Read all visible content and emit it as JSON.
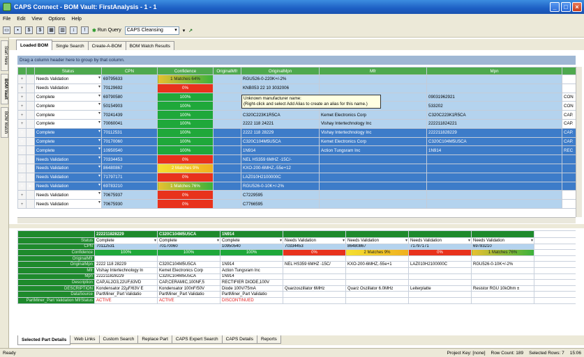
{
  "window": {
    "title": "CAPS Connect - BOM Vault: FirstAnalysis - 1 - 1"
  },
  "menu": [
    "File",
    "Edit",
    "View",
    "Options",
    "Help"
  ],
  "toolbar": {
    "run_query": "Run Query",
    "query_select": "CAPS Cleansing"
  },
  "side_tabs": [
    "Start Here",
    "BOM Vault",
    "BOM Watch"
  ],
  "top_tabs": [
    "Loaded BOM",
    "Single Search",
    "Create-A-BOM",
    "BOM Watch Results"
  ],
  "group_hint": "Drag a column header here to group by that column.",
  "grid": {
    "columns": [
      "Status",
      "CPN",
      "Confidence",
      "OriginalMfr",
      "OriginalMpn",
      "Mfr",
      "Mpn",
      ""
    ],
    "rows": [
      {
        "status": "Needs Validation",
        "cpn": "69795633",
        "conf": "1 Matches 64%",
        "ctype": "mixed",
        "omfr": "",
        "ompn": "RGU526-0-220K+/-2%",
        "mfr": "",
        "mpn": "",
        "extra": "",
        "sel": false
      },
      {
        "status": "Needs Validation",
        "cpn": "70129692",
        "conf": "0%",
        "ctype": "red",
        "omfr": "",
        "ompn": "KNB053 22 10 3032006",
        "mfr": "",
        "mpn": "",
        "extra": "",
        "sel": false
      },
      {
        "status": "Complete",
        "cpn": "69790580",
        "conf": "100%",
        "ctype": "green",
        "omfr": "",
        "ompn": "",
        "mfr": "",
        "mpn": "09031962921",
        "extra": "CON",
        "sel": false
      },
      {
        "status": "Complete",
        "cpn": "50154903",
        "conf": "100%",
        "ctype": "green",
        "omfr": "",
        "ompn": "533202",
        "mfr": "Emi Electronics Inc",
        "mpn": "533202",
        "extra": "CON",
        "sel": false
      },
      {
        "status": "Complete",
        "cpn": "70241439",
        "conf": "100%",
        "ctype": "green",
        "omfr": "",
        "ompn": "C320C223K1R5CA",
        "mfr": "Kemet Electronics Corp",
        "mpn": "C320C223K1R5CA",
        "extra": "CAP.",
        "sel": false
      },
      {
        "status": "Complete",
        "cpn": "70060041",
        "conf": "100%",
        "ctype": "green",
        "omfr": "",
        "ompn": "2222 118 24221",
        "mfr": "Vishay Intertechnology Inc",
        "mpn": "222211824221",
        "extra": "CAP.",
        "sel": false
      },
      {
        "status": "Complete",
        "cpn": "70112531",
        "conf": "100%",
        "ctype": "green",
        "omfr": "",
        "ompn": "2222 118 28229",
        "mfr": "Vishay Intertechnology Inc",
        "mpn": "222211828229",
        "extra": "CAP.",
        "sel": true
      },
      {
        "status": "Complete",
        "cpn": "70170060",
        "conf": "100%",
        "ctype": "green",
        "omfr": "",
        "ompn": "C320C104M5U5CA",
        "mfr": "Kemet Electronics Corp",
        "mpn": "C320C104M5U5CA",
        "extra": "CAP.",
        "sel": true
      },
      {
        "status": "Complete",
        "cpn": "10950540",
        "conf": "100%",
        "ctype": "green",
        "omfr": "",
        "ompn": "1N914",
        "mfr": "Action Tungsram Inc",
        "mpn": "1N914",
        "extra": "REC",
        "sel": true
      },
      {
        "status": "Needs Validation",
        "cpn": "70334453",
        "conf": "0%",
        "ctype": "red",
        "omfr": "",
        "ompn": "NEL HS359 6MHZ -15C/-",
        "mfr": "",
        "mpn": "",
        "extra": "",
        "sel": true
      },
      {
        "status": "Needs Validation",
        "cpn": "86480867",
        "conf": "2 Matches 9%",
        "ctype": "yellow",
        "omfr": "",
        "ompn": "KXO-200-6MHZ,-55e+12",
        "mfr": "",
        "mpn": "",
        "extra": "",
        "sel": true
      },
      {
        "status": "Needs Validation",
        "cpn": "71797171",
        "conf": "0%",
        "ctype": "red",
        "omfr": "",
        "ompn": "LAZ010H2100000C",
        "mfr": "",
        "mpn": "",
        "extra": "",
        "sel": true
      },
      {
        "status": "Needs Validation",
        "cpn": "69783210",
        "conf": "1 Matches 76%",
        "ctype": "mixed",
        "omfr": "",
        "ompn": "RGU526-0-10K+/-2%",
        "mfr": "",
        "mpn": "",
        "extra": "",
        "sel": true
      },
      {
        "status": "Needs Validation",
        "cpn": "70675937",
        "conf": "0%",
        "ctype": "red",
        "omfr": "",
        "ompn": "C7229595",
        "mfr": "",
        "mpn": "",
        "extra": "",
        "sel": false
      },
      {
        "status": "Needs Validation",
        "cpn": "70675930",
        "conf": "0%",
        "ctype": "red",
        "omfr": "",
        "ompn": "C7766595",
        "mfr": "",
        "mpn": "",
        "extra": "",
        "sel": false
      }
    ]
  },
  "tooltip": {
    "line1": "Unknown manufacturer name:",
    "line2": "(Right-click and select Add Alias to create an alias for this name.)"
  },
  "details": {
    "labels": [
      "Status",
      "CPN",
      "Confidence",
      "OriginalMfr",
      "OriginalMpn",
      "Mfr",
      "Mpn",
      "Description",
      "DESCRIPTION",
      "DataSource",
      "PartMiner_Part Validation MfrStatus"
    ],
    "headers": [
      "222211828229",
      "C320C104M5U5CA",
      "1N914",
      "",
      "",
      "",
      ""
    ],
    "cols": [
      {
        "status": "Complete",
        "cpn": "70112531",
        "conf": "100%",
        "ctype": "green",
        "omfr": "",
        "ompn": "2222 118 28229",
        "mfr": "Vishay Intertechnology In",
        "mpn": "222211828229",
        "desc": "CAP,AL2O3,22UF,63VD",
        "desc2": "Kondensator 22µF/63V E",
        "ds": "PartMiner_Part Validatio",
        "ms": "ACTIVE"
      },
      {
        "status": "Complete",
        "cpn": "70170060",
        "conf": "100%",
        "ctype": "green",
        "omfr": "",
        "ompn": "C320C104M5U5CA",
        "mfr": "Kemet Electronics Corp",
        "mpn": "C320C104M5U5CA",
        "desc": "CAP,CERAMIC,100NF,5",
        "desc2": "Kondensator 100nF/50V",
        "ds": "PartMiner_Part Validatio",
        "ms": "ACTIVE"
      },
      {
        "status": "Complete",
        "cpn": "10950540",
        "conf": "100%",
        "ctype": "green",
        "omfr": "",
        "ompn": "1N914",
        "mfr": "Action Tungsram Inc",
        "mpn": "1N914",
        "desc": "RECTIFIER DIODE,100V",
        "desc2": "Diode 100V/75mA",
        "ds": "PartMiner_Part Validatio",
        "ms": "DISCONTINUED"
      },
      {
        "status": "Needs Validation",
        "cpn": "70334453",
        "conf": "0%",
        "ctype": "red",
        "omfr": "",
        "ompn": "NEL HS359 6MHZ -15C/",
        "mfr": "",
        "mpn": "",
        "desc": "",
        "desc2": "Quarzoszillator 6MHz",
        "ds": "",
        "ms": ""
      },
      {
        "status": "Needs Validation",
        "cpn": "86480867",
        "conf": "2 Matches 9%",
        "ctype": "yellow",
        "omfr": "",
        "ompn": "KXO-200-6MHZ,-55e+1",
        "mfr": "",
        "mpn": "",
        "desc": "",
        "desc2": "Quarz Oszillator 6.0MHz",
        "ds": "",
        "ms": ""
      },
      {
        "status": "Needs Validation",
        "cpn": "71797171",
        "conf": "0%",
        "ctype": "red",
        "omfr": "",
        "ompn": "LAZ010H2100000C",
        "mfr": "",
        "mpn": "",
        "desc": "",
        "desc2": "Leiterplatte",
        "ds": "",
        "ms": ""
      },
      {
        "status": "Needs Validation",
        "cpn": "69783210",
        "conf": "1 Matches 76%",
        "ctype": "mixed",
        "omfr": "",
        "ompn": "RGU526-0-10K+/-2%",
        "mfr": "",
        "mpn": "",
        "desc": "",
        "desc2": "Resistor RGU 10kOhm ±",
        "ds": "",
        "ms": ""
      }
    ]
  },
  "bottom_tabs": [
    "Selected Part Details",
    "Web Links",
    "Custom Search",
    "Replace Part",
    "CAPS Expert Search",
    "CAPS Details",
    "Reports"
  ],
  "status": {
    "left": "Ready",
    "project_key": "Project Key: [none]",
    "row_count": "Row Count: 189",
    "selected_rows": "Selected Rows: 7",
    "time": "15:06"
  }
}
